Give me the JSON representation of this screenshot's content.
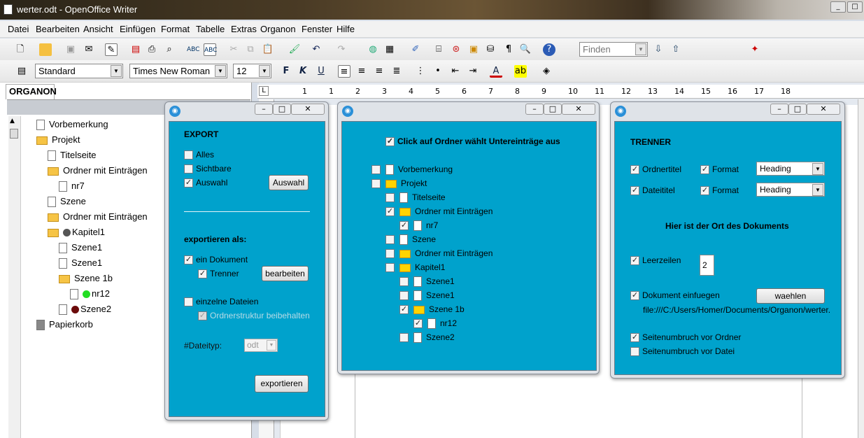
{
  "window": {
    "title": "werter.odt - OpenOffice Writer"
  },
  "menu": [
    "Datei",
    "Bearbeiten",
    "Ansicht",
    "Einfügen",
    "Format",
    "Tabelle",
    "Extras",
    "Organon",
    "Fenster",
    "Hilfe"
  ],
  "toolbar": {
    "find_placeholder": "Finden",
    "style": "Standard",
    "font": "Times New Roman",
    "size": "12"
  },
  "navigator": {
    "tab": "ORGANON",
    "items": [
      {
        "label": "Vorbemerkung",
        "type": "file",
        "level": 0
      },
      {
        "label": "Projekt",
        "type": "folder",
        "level": 0
      },
      {
        "label": "Titelseite",
        "type": "file",
        "level": 1
      },
      {
        "label": "Ordner mit Einträgen",
        "type": "folder",
        "level": 1
      },
      {
        "label": "nr7",
        "type": "file",
        "level": 2
      },
      {
        "label": "Szene",
        "type": "file",
        "level": 1
      },
      {
        "label": "Ordner mit Einträgen",
        "type": "folder",
        "level": 1
      },
      {
        "label": "Kapitel1",
        "type": "folder",
        "level": 1,
        "dot": "#555555"
      },
      {
        "label": "Szene1",
        "type": "file",
        "level": 2
      },
      {
        "label": "Szene1",
        "type": "file",
        "level": 2
      },
      {
        "label": "Szene 1b",
        "type": "folder",
        "level": 2
      },
      {
        "label": "nr12",
        "type": "file",
        "level": 3,
        "dot": "#22dd22"
      },
      {
        "label": "Szene2",
        "type": "file",
        "level": 2,
        "dot": "#6b0a0a"
      },
      {
        "label": "Papierkorb",
        "type": "trash",
        "level": 0
      }
    ]
  },
  "ruler": {
    "ticks": [
      "1",
      "1",
      "2",
      "3",
      "4",
      "5",
      "6",
      "7",
      "8",
      "9",
      "10",
      "11",
      "12",
      "13",
      "14",
      "15",
      "16",
      "17",
      "18"
    ]
  },
  "export_dialog": {
    "heading": "EXPORT",
    "alles": "Alles",
    "sichtbare": "Sichtbare",
    "auswahl": "Auswahl",
    "auswahl_button": "Auswahl",
    "export_as": "exportieren als:",
    "ein_dokument": "ein Dokument",
    "trenner": "Trenner",
    "bearbeiten_button": "bearbeiten",
    "einzelne": "einzelne Dateien",
    "ordnerstruktur": "Ordnerstruktur beibehalten",
    "dateityp_label": "#Dateityp:",
    "dateityp_value": "odt",
    "export_button": "exportieren"
  },
  "tree_dialog": {
    "header_option": "Click auf Ordner wählt Untereinträge aus",
    "items": [
      {
        "label": "Vorbemerkung",
        "type": "file",
        "level": 0,
        "checked": false
      },
      {
        "label": "Projekt",
        "type": "folder",
        "level": 0,
        "checked": false
      },
      {
        "label": "Titelseite",
        "type": "file",
        "level": 1,
        "checked": false
      },
      {
        "label": "Ordner mit Einträgen",
        "type": "folder",
        "level": 1,
        "checked": true
      },
      {
        "label": "nr7",
        "type": "file",
        "level": 2,
        "checked": true
      },
      {
        "label": "Szene",
        "type": "file",
        "level": 1,
        "checked": false
      },
      {
        "label": "Ordner mit Einträgen",
        "type": "folder",
        "level": 1,
        "checked": false
      },
      {
        "label": "Kapitel1",
        "type": "folder",
        "level": 1,
        "checked": false
      },
      {
        "label": "Szene1",
        "type": "file",
        "level": 2,
        "checked": false
      },
      {
        "label": "Szene1",
        "type": "file",
        "level": 2,
        "checked": false
      },
      {
        "label": "Szene 1b",
        "type": "folder",
        "level": 2,
        "checked": true
      },
      {
        "label": "nr12",
        "type": "file",
        "level": 3,
        "checked": true
      },
      {
        "label": "Szene2",
        "type": "file",
        "level": 2,
        "checked": false
      }
    ]
  },
  "trenner_dialog": {
    "heading": "TRENNER",
    "ordnertitel": "Ordnertitel",
    "dateititel": "Dateititel",
    "format": "Format",
    "heading_value": "Heading",
    "ort_label": "Hier ist der Ort des Dokuments",
    "leerzeilen": "Leerzeilen",
    "leerzeilen_value": "2",
    "dokument_einfuegen": "Dokument einfuegen",
    "waehlen_button": "waehlen",
    "path": "file:///C:/Users/Homer/Documents/Organon/werter.",
    "seitenumbruch_ordner": "Seitenumbruch vor Ordner",
    "seitenumbruch_datei": "Seitenumbruch vor Datei"
  }
}
